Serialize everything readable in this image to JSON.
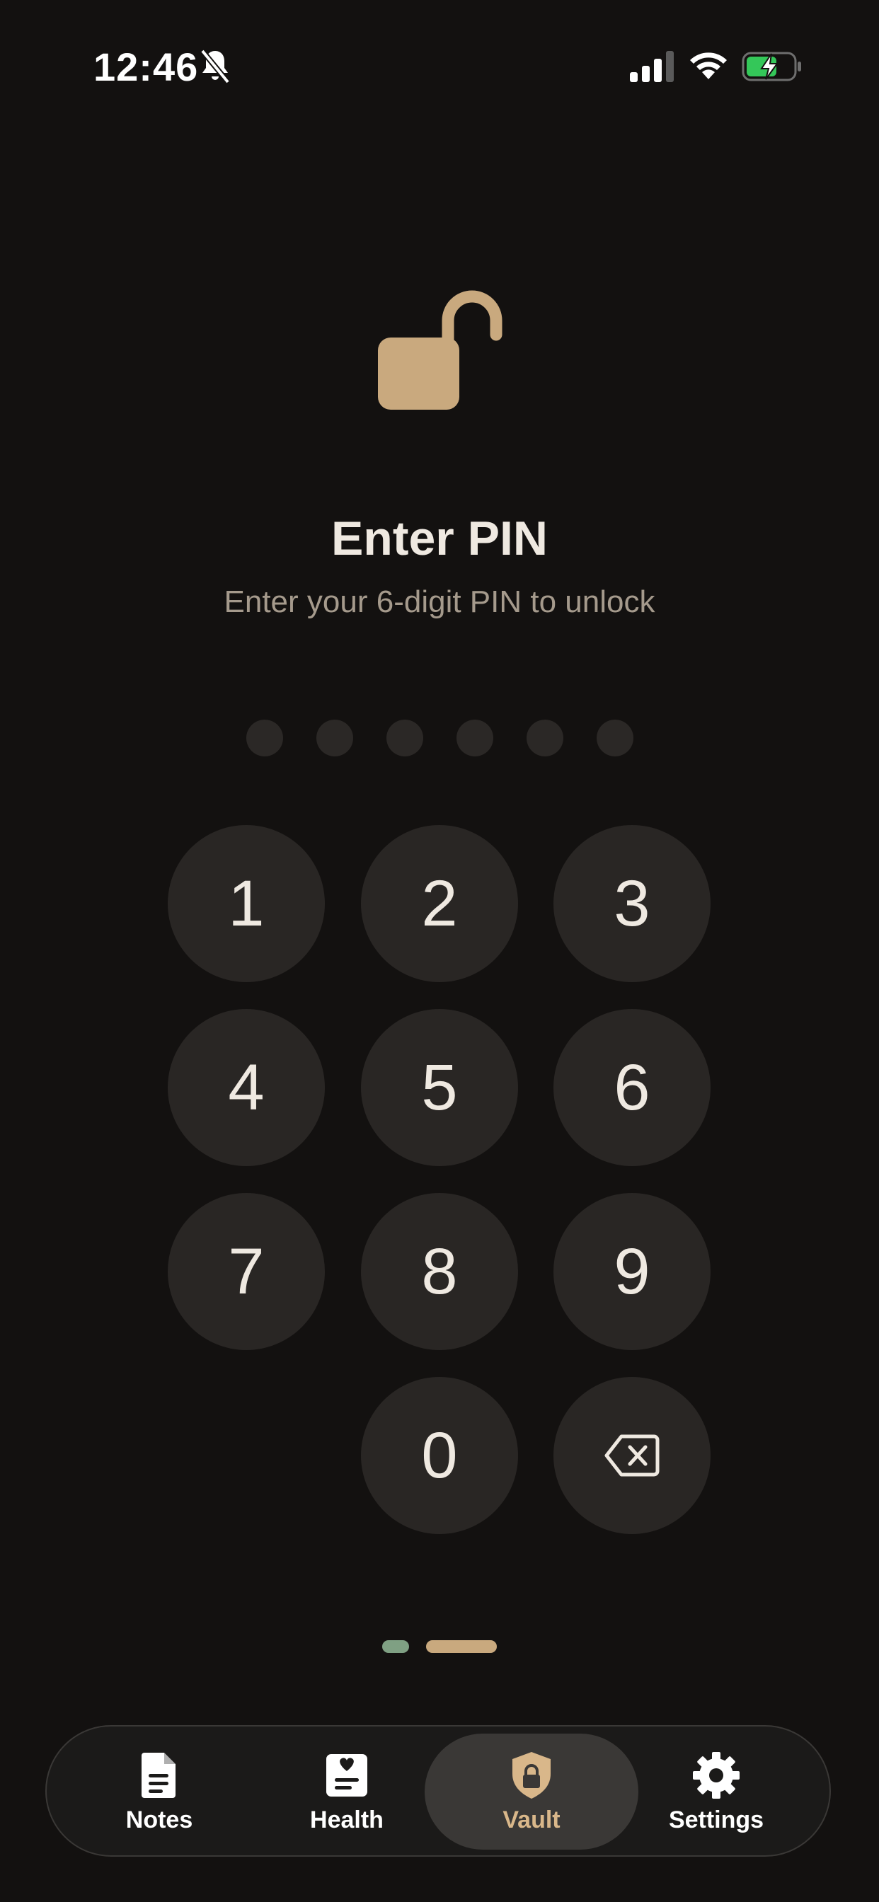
{
  "status_bar": {
    "time": "12:46",
    "icons": [
      "bell-slash-icon",
      "cellular-signal-icon",
      "wifi-icon",
      "battery-charging-icon"
    ]
  },
  "lock_screen": {
    "icon": "unlocked-padlock-icon",
    "title": "Enter PIN",
    "subtitle": "Enter your 6-digit PIN to unlock",
    "pin_length": 6,
    "pin_filled": 0
  },
  "keypad": {
    "keys": [
      "1",
      "2",
      "3",
      "4",
      "5",
      "6",
      "7",
      "8",
      "9",
      "0"
    ],
    "backspace_icon": "backspace-icon"
  },
  "page_indicator": {
    "pages": 2,
    "current": 2
  },
  "tabbar": {
    "tabs": [
      {
        "label": "Notes",
        "icon": "document-icon"
      },
      {
        "label": "Health",
        "icon": "health-card-icon"
      },
      {
        "label": "Vault",
        "icon": "shield-lock-icon"
      },
      {
        "label": "Settings",
        "icon": "gear-icon"
      }
    ],
    "active": 2
  },
  "colors": {
    "background": "#131110",
    "accent": "#c9a97e",
    "accent_label": "#d9b78a",
    "key_bg": "#292624",
    "dot_bg": "#2b2826",
    "indicator_green": "#7fa083",
    "battery_green": "#34c759"
  }
}
